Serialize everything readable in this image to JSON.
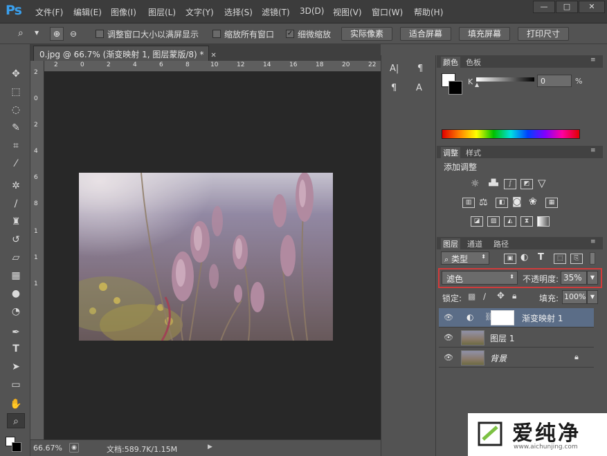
{
  "app": {
    "logo": "Ps"
  },
  "menu": [
    "文件(F)",
    "编辑(E)",
    "图像(I)",
    "图层(L)",
    "文字(Y)",
    "选择(S)",
    "滤镜(T)",
    "3D(D)",
    "视图(V)",
    "窗口(W)",
    "帮助(H)"
  ],
  "window_controls": {
    "minimize": "—",
    "maximize": "□",
    "close": "✕"
  },
  "options": {
    "resize_windows": "调整窗口大小以满屏显示",
    "zoom_all": "缩放所有窗口",
    "scrubby_zoom": "细微缩放",
    "actual_pixels": "实际像素",
    "fit_screen": "适合屏幕",
    "fill_screen": "填充屏幕",
    "print_size": "打印尺寸"
  },
  "document": {
    "tab_title": "0.jpg @ 66.7% (渐变映射 1, 图层蒙版/8) *",
    "h_ruler": [
      "2",
      "0",
      "2",
      "4",
      "6",
      "8",
      "10",
      "12",
      "14",
      "16",
      "18",
      "20",
      "22"
    ],
    "v_ruler": [
      "2",
      "0",
      "2",
      "4",
      "6",
      "8",
      "1",
      "1",
      "1"
    ]
  },
  "status": {
    "zoom": "66.67%",
    "doc_size": "文档:589.7K/1.15M"
  },
  "color_panel": {
    "tabs": [
      "颜色",
      "色板"
    ],
    "channel": "K",
    "value": "0",
    "unit": "%"
  },
  "adjust_panel": {
    "tabs": [
      "调整",
      "样式"
    ],
    "title": "添加调整"
  },
  "layers_panel": {
    "tabs": [
      "图层",
      "通道",
      "路径"
    ],
    "filter_kind": "类型",
    "blend_mode": "滤色",
    "opacity_label": "不透明度:",
    "opacity_value": "35%",
    "lock_label": "锁定:",
    "fill_label": "填充:",
    "fill_value": "100%",
    "layers": [
      {
        "name": "渐变映射 1",
        "selected": true
      },
      {
        "name": "图层 1",
        "selected": false
      },
      {
        "name": "背景",
        "selected": false
      }
    ]
  },
  "watermark": {
    "brand": "爱纯净",
    "url": "www.aichunjing.com"
  },
  "colors": {
    "accent_highlight": "#d23b3b",
    "selected_layer": "#5b6d87"
  }
}
